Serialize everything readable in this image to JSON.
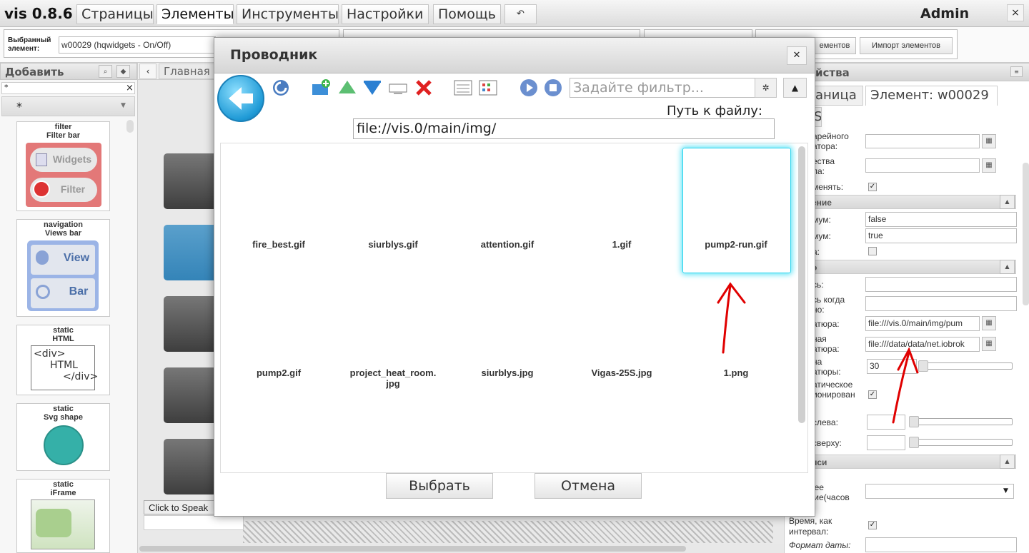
{
  "app": {
    "version": "vis 0.8.6",
    "user": "Admin",
    "close": "×"
  },
  "menu": {
    "tabs": [
      "Страницы",
      "Элементы",
      "Инструменты",
      "Настройки",
      "Помощь",
      "↶"
    ]
  },
  "toolbar": {
    "selected_label_1": "Выбранный",
    "selected_label_2": "элемент:",
    "selected_value": "w00029 (hqwidgets - On/Off)",
    "export_btn": "ементов",
    "import_btn": "Импорт элементов"
  },
  "left": {
    "header": "Добавить",
    "filter_value": "*",
    "filter_select": "*",
    "tiles": [
      {
        "set": "filter",
        "name": "Filter bar",
        "b1": "Widgets",
        "b2": "Filter"
      },
      {
        "set": "navigation",
        "name": "Views bar",
        "b1": "View",
        "b2": "Bar"
      },
      {
        "set": "static",
        "name": "HTML",
        "html1": "<div>",
        "html2": "HTML",
        "html3": "</div>"
      },
      {
        "set": "static",
        "name": "Svg shape"
      },
      {
        "set": "static",
        "name": "iFrame"
      }
    ]
  },
  "canvas": {
    "breadcrumb": "Главная",
    "speak": "Click to Speak"
  },
  "right": {
    "header": "йства",
    "tab_page": "аница",
    "tab_element": "Элемент: w00029",
    "tab_extra": "S",
    "rows": {
      "r1a": "арейного",
      "r1b": "атора:",
      "r2a": "ества",
      "r2b": "ла:",
      "r3": "менять:",
      "sect1": "ение",
      "min": "мум:",
      "min_val": "false",
      "max": "мум:",
      "max_val": "true",
      "inv": "а:",
      "sect2": "о",
      "t1": "сь:",
      "t2a": "сь когда",
      "t2b": "но:",
      "t3": "атюра:",
      "t3_val": "file:///vis.0/main/img/pum",
      "t4a": "ная",
      "t4b": "атюра:",
      "t4_val": "file:///data/data/net.iobrok",
      "t5a": "на",
      "t5b": "атюры:",
      "t5_val": "30",
      "t6a": "атическое",
      "t6b": "ионирован",
      "left": "слева:",
      "top": "сверху:",
      "sect3": "иси",
      "s1": "ь",
      "s2": "днее",
      "s3": "ение(часов",
      "time_a": "Время, как",
      "time_b": "интервал:",
      "date": "Формат даты:"
    }
  },
  "dialog": {
    "title": "Проводник",
    "filter_placeholder": "Задайте фильтр...",
    "path_label": "Путь к файлу:",
    "path_value": "file://vis.0/main/img/",
    "files": [
      "fire_best.gif",
      "siurblys.gif",
      "attention.gif",
      "1.gif",
      "pump2-run.gif",
      "pump2.gif",
      "project_heat_room.\njpg",
      "siurblys.jpg",
      "Vigas-25S.jpg",
      "1.png"
    ],
    "selected_file": "pump2-run.gif",
    "ok": "Выбрать",
    "cancel": "Отмена"
  },
  "colors": {
    "accent_blue": "#2f8fd0",
    "selected_glow": "#28d8f0",
    "annotation_red": "#e00000"
  }
}
